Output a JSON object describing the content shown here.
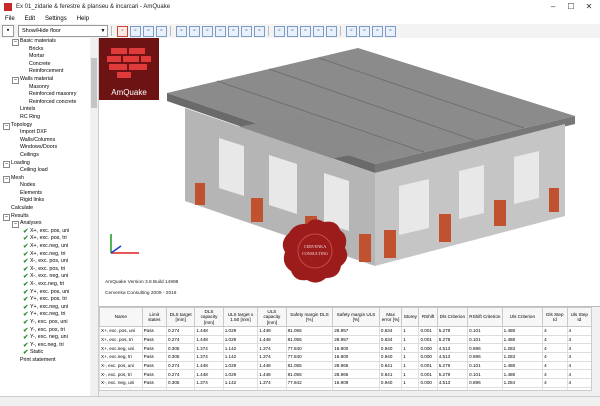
{
  "window": {
    "title": "Ex 01_zidarie & ferestre & planseu & incarcari - AmQuake",
    "buttons": [
      "–",
      "☐",
      "✕"
    ]
  },
  "menu": [
    "File",
    "Edit",
    "Settings",
    "Help"
  ],
  "toolbar": {
    "dropdown_value": "Show/Hide floor",
    "icons": [
      "save-icon",
      "floor-view-icon",
      "cube-icon",
      "rotate-icon",
      "wall-icon",
      "window-icon",
      "door-icon",
      "column-icon",
      "mesh-icon",
      "node-icon",
      "element-icon",
      "link-icon",
      "load-icon",
      "calc-icon",
      "result-icon",
      "zoom-in-icon",
      "zoom-out-icon",
      "fit-icon",
      "pan-icon",
      "settings-icon"
    ]
  },
  "tree": [
    {
      "level": 1,
      "label": "Basic materials",
      "expander": "–"
    },
    {
      "level": 2,
      "label": "Bricks"
    },
    {
      "level": 2,
      "label": "Mortar"
    },
    {
      "level": 2,
      "label": "Concrete"
    },
    {
      "level": 2,
      "label": "Reinforcement"
    },
    {
      "level": 1,
      "label": "Walls material",
      "expander": "–"
    },
    {
      "level": 2,
      "label": "Masonry"
    },
    {
      "level": 2,
      "label": "Reinforced masonry"
    },
    {
      "level": 2,
      "label": "Reinforced concrete"
    },
    {
      "level": 1,
      "label": "Lintels"
    },
    {
      "level": 1,
      "label": "RC Ring"
    },
    {
      "level": 0,
      "label": "Topology",
      "expander": "–"
    },
    {
      "level": 1,
      "label": "Import DXF"
    },
    {
      "level": 1,
      "label": "Walls/Columns"
    },
    {
      "level": 1,
      "label": "Windows/Doors"
    },
    {
      "level": 1,
      "label": "Ceilings"
    },
    {
      "level": 0,
      "label": "Loading",
      "expander": "–"
    },
    {
      "level": 1,
      "label": "Ceiling load"
    },
    {
      "level": 0,
      "label": "Mesh",
      "expander": "–"
    },
    {
      "level": 1,
      "label": "Nodes"
    },
    {
      "level": 1,
      "label": "Elements"
    },
    {
      "level": 1,
      "label": "Rigid links"
    },
    {
      "level": 0,
      "label": "Calculate"
    },
    {
      "level": 0,
      "label": "Results",
      "expander": "–"
    },
    {
      "level": 1,
      "label": "Analyses",
      "expander": "–"
    },
    {
      "level": 2,
      "label": "X+, exc. pos, uni",
      "check": true
    },
    {
      "level": 2,
      "label": "X+, exc. pos, tri",
      "check": true
    },
    {
      "level": 2,
      "label": "X+, exc.neg, uni",
      "check": true
    },
    {
      "level": 2,
      "label": "X+, exc.neg, tri",
      "check": true
    },
    {
      "level": 2,
      "label": "X-, exc. pos, uni",
      "check": true
    },
    {
      "level": 2,
      "label": "X-, exc. pos, tri",
      "check": true
    },
    {
      "level": 2,
      "label": "X-, exc. neg, uni",
      "check": true
    },
    {
      "level": 2,
      "label": "X-, exc.neg, tri",
      "check": true
    },
    {
      "level": 2,
      "label": "Y+, exc. pos, uni",
      "check": true
    },
    {
      "level": 2,
      "label": "Y+, exc. pos, tri",
      "check": true
    },
    {
      "level": 2,
      "label": "Y+, exc.neg, uni",
      "check": true
    },
    {
      "level": 2,
      "label": "Y+, exc.neg, tri",
      "check": true
    },
    {
      "level": 2,
      "label": "Y-, exc. pos, uni",
      "check": true
    },
    {
      "level": 2,
      "label": "Y-, exc. pos, tri",
      "check": true
    },
    {
      "level": 2,
      "label": "Y-, exc. neg, uni",
      "check": true
    },
    {
      "level": 2,
      "label": "Y-, exc.neg, tri",
      "check": true
    },
    {
      "level": 2,
      "label": "Static",
      "check": true
    },
    {
      "level": 1,
      "label": "Print statement"
    }
  ],
  "viewport": {
    "logo_text": "AmQuake",
    "version": "AmQuake Version 3.8 Build 14998",
    "copyright": "Cervenka Consulting 2009 - 2016",
    "seal_text": [
      "CERVENKA",
      "CONSULTING"
    ],
    "colors": {
      "concrete": "#8a8a8a",
      "masonry": "#b9b9b9",
      "brick": "#c0522f",
      "logo": "#6d1313",
      "seal": "#9c1b1b"
    }
  },
  "results": {
    "columns": [
      "Name",
      "Limit states",
      "DLS target [mm]",
      "DLS capacity [mm]",
      "ULS target x 1.50 [mm]",
      "ULS capacity [mm]",
      "Safety margin DLS [%]",
      "Safety margin ULS [%]",
      "Max error [%]",
      "Storey",
      "RShift",
      "Dls Criterion",
      "RShift Criterion",
      "Uls Criterion",
      "Dls Step Id",
      "Uls Step Id"
    ],
    "rows": [
      [
        "X+, exc. pos, uni",
        "Pass",
        "0.274",
        "1.448",
        "1.029",
        "1.448",
        "81.055",
        "28.957",
        "0.634",
        "1",
        "0.001",
        "5.278",
        "0.101",
        "1.488",
        "4",
        "4"
      ],
      [
        "X+, exc. pos, tri",
        "Pass",
        "0.274",
        "1.448",
        "1.029",
        "1.448",
        "81.055",
        "28.957",
        "0.634",
        "1",
        "0.001",
        "5.278",
        "0.101",
        "1.488",
        "4",
        "4"
      ],
      [
        "X+, exc.neg, uni",
        "Pass",
        "0.305",
        "1.374",
        "1.142",
        "1.374",
        "77.840",
        "16.900",
        "0.940",
        "1",
        "0.000",
        "4.513",
        "0.896",
        "1.283",
        "4",
        "4"
      ],
      [
        "X+, exc.neg, tri",
        "Pass",
        "0.305",
        "1.374",
        "1.142",
        "1.374",
        "77.840",
        "16.900",
        "0.940",
        "1",
        "0.000",
        "4.513",
        "0.896",
        "1.283",
        "4",
        "4"
      ],
      [
        "X-, exc. pos, uni",
        "Pass",
        "0.274",
        "1.448",
        "1.029",
        "1.448",
        "81.055",
        "28.966",
        "0.641",
        "1",
        "0.001",
        "5.279",
        "0.101",
        "1.488",
        "4",
        "4"
      ],
      [
        "X-, exc. pos, tri",
        "Pass",
        "0.274",
        "1.448",
        "1.029",
        "1.448",
        "81.055",
        "28.966",
        "0.641",
        "1",
        "0.001",
        "5.279",
        "0.101",
        "1.488",
        "4",
        "4"
      ],
      [
        "X-, exc. neg, uni",
        "Pass",
        "0.305",
        "1.374",
        "1.142",
        "1.374",
        "77.842",
        "16.909",
        "0.940",
        "1",
        "0.000",
        "4.513",
        "0.896",
        "1.284",
        "4",
        "4"
      ],
      [
        "X-, exc.neg, tri",
        "Pass",
        "0.305",
        "1.374",
        "1.142",
        "1.374",
        "77.842",
        "16.909",
        "0.940",
        "1",
        "0.000",
        "4.513",
        "0.896",
        "1.284",
        "4",
        "4"
      ]
    ]
  }
}
